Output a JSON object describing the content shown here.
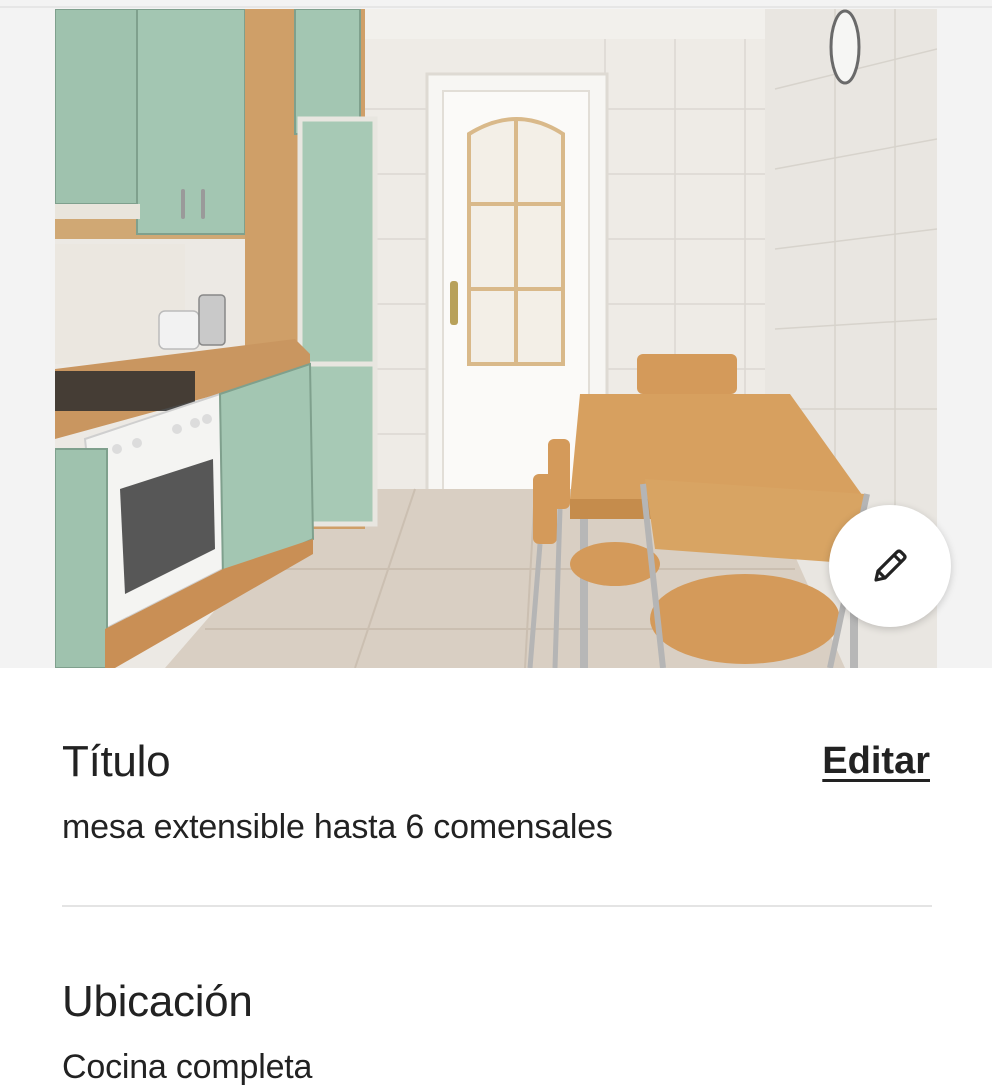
{
  "photo": {
    "alt_semantic": "kitchen-photo",
    "edit_icon": "pencil-icon"
  },
  "title_section": {
    "label": "Título",
    "value": "mesa extensible hasta 6 comensales",
    "edit_label": "Editar"
  },
  "location_section": {
    "label": "Ubicación",
    "value": "Cocina completa"
  },
  "colors": {
    "text": "#222222",
    "divider": "#e4e4e4",
    "background": "#ffffff"
  }
}
